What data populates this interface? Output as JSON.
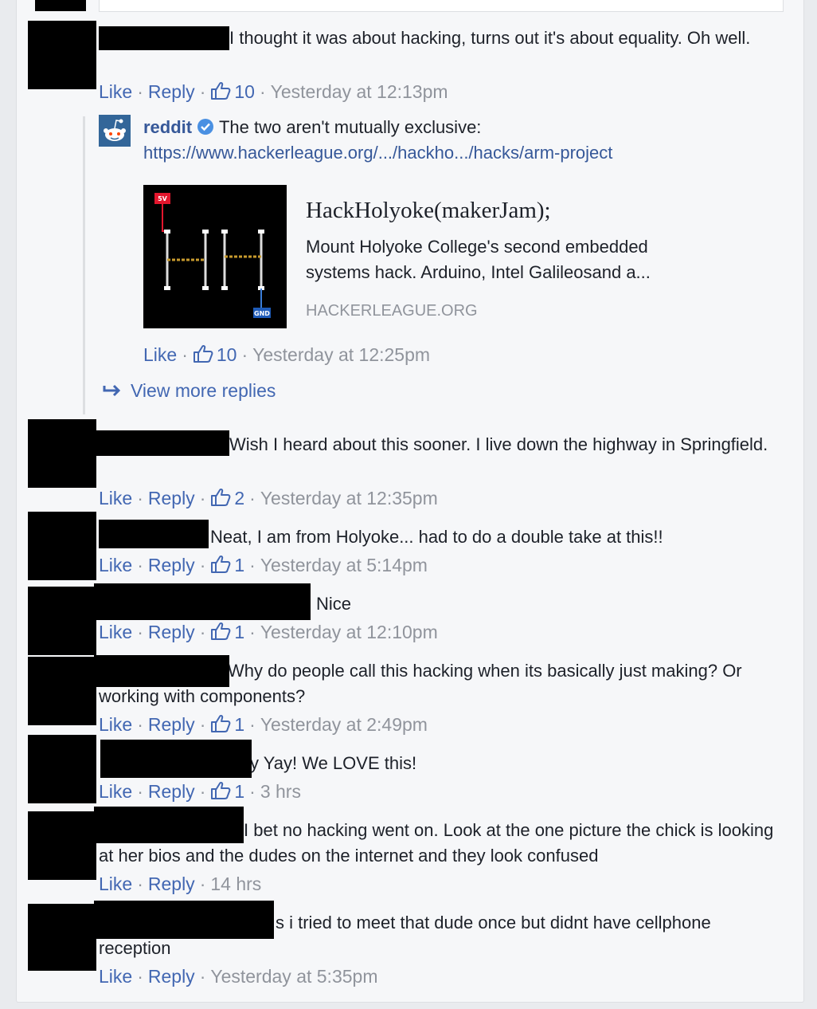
{
  "actions": {
    "like": "Like",
    "reply": "Reply",
    "separator": "·"
  },
  "colors": {
    "link": "#4267b2",
    "meta": "#90949c",
    "text": "#1d2129",
    "verified": "#4a90e2",
    "reddit_orange": "#ff4500"
  },
  "comments": [
    {
      "text": "I thought it was about hacking, turns out it's about equality. Oh well.",
      "likes": "10",
      "time": "Yesterday at 12:13pm"
    },
    {
      "text": "Wish I heard about this sooner. I live down the highway in Springfield.",
      "likes": "2",
      "time": "Yesterday at 12:35pm"
    },
    {
      "text": "Neat, I am from Holyoke... had to do a double take at this!!",
      "likes": "1",
      "time": "Yesterday at 5:14pm"
    },
    {
      "text": "i Nice",
      "likes": "1",
      "time": "Yesterday at 12:10pm"
    },
    {
      "text": "Why do people call this hacking when its basically just making? Or working with components?",
      "likes": "1",
      "time": "Yesterday at 2:49pm"
    },
    {
      "text": "y Yay! We LOVE this!",
      "likes": "1",
      "time": "3 hrs"
    },
    {
      "text": "I bet no hacking went on. Look at the one picture the chick is looking at her bios and the dudes on the internet and they look confused",
      "time": "14 hrs"
    },
    {
      "text": "s i tried to meet that dude once but didnt have cellphone reception",
      "time": "Yesterday at 5:35pm"
    }
  ],
  "reply": {
    "author": "reddit",
    "text": "The two aren't mutually exclusive:",
    "url": "https://www.hackerleague.org/.../hackho.../hacks/arm-project",
    "likes": "10",
    "time": "Yesterday at 12:25pm",
    "preview": {
      "title": "HackHolyoke(makerJam);",
      "description": "Mount Holyoke College's second embedded systems hack. Arduino, Intel Galileosand a...",
      "domain": "HACKERLEAGUE.ORG",
      "thumb_labels": {
        "top": "5V",
        "bottom": "GND"
      }
    }
  },
  "view_more_replies": "View more replies"
}
